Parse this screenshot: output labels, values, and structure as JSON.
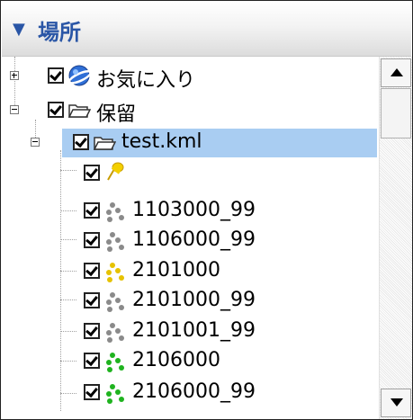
{
  "header": {
    "title": "場所",
    "collapse_icon": "triangle-down"
  },
  "tree": {
    "items": [
      {
        "label": "お気に入り",
        "icon": "globe-icon",
        "level": 0,
        "expander": "plus"
      },
      {
        "label": "保留",
        "icon": "folder-open-icon",
        "level": 0,
        "expander": "minus"
      },
      {
        "label": "test.kml",
        "icon": "folder-open-icon",
        "level": 1,
        "expander": "minus",
        "selected": true
      },
      {
        "label": "",
        "icon": "pushpin-icon",
        "level": 2
      },
      {
        "label": "1103000_99",
        "icon": "path-gray-icon",
        "level": 2
      },
      {
        "label": "1106000_99",
        "icon": "path-gray-icon",
        "level": 2
      },
      {
        "label": "2101000",
        "icon": "path-yellow-icon",
        "level": 2
      },
      {
        "label": "2101000_99",
        "icon": "path-gray-icon",
        "level": 2
      },
      {
        "label": "2101001_99",
        "icon": "path-gray-icon",
        "level": 2
      },
      {
        "label": "2106000",
        "icon": "path-green-icon",
        "level": 2
      },
      {
        "label": "2106000_99",
        "icon": "path-green-icon",
        "level": 2
      }
    ]
  },
  "colors": {
    "header_text": "#2a56a6",
    "selection": "#a9cdf2"
  }
}
